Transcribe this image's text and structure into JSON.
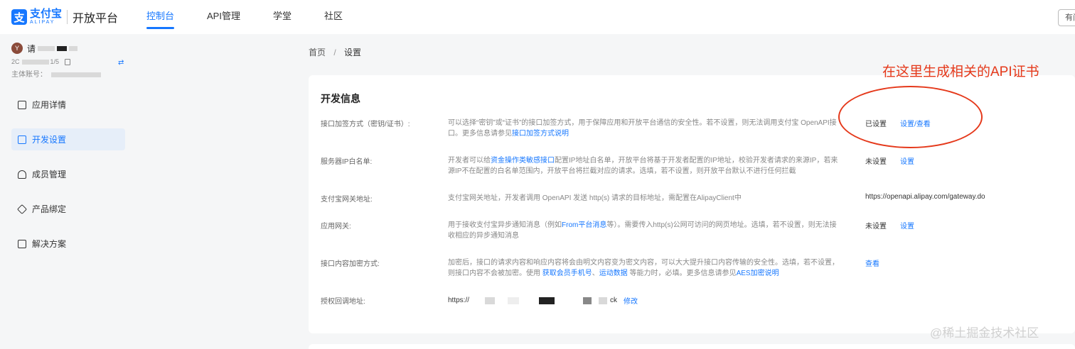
{
  "header": {
    "logo_icon": "支",
    "logo_cn": "支付宝",
    "logo_en": "ALIPAY",
    "platform": "开放平台",
    "nav": [
      {
        "label": "控制台",
        "active": true
      },
      {
        "label": "API管理",
        "active": false
      },
      {
        "label": "学堂",
        "active": false
      },
      {
        "label": "社区",
        "active": false
      }
    ],
    "right_button": "有问"
  },
  "sidebar": {
    "account_name": "请",
    "avatar_letter": "Y",
    "account_id": "2C",
    "account_id_suffix": "1/5",
    "main_account_label": "主体账号：",
    "swap_icon": "swap-icon",
    "menu": [
      {
        "label": "应用详情",
        "icon": "app-detail-icon",
        "active": false
      },
      {
        "label": "开发设置",
        "icon": "dev-settings-icon",
        "active": true
      },
      {
        "label": "成员管理",
        "icon": "members-icon",
        "active": false
      },
      {
        "label": "产品绑定",
        "icon": "product-bind-icon",
        "active": false
      },
      {
        "label": "解决方案",
        "icon": "solution-icon",
        "active": false
      }
    ]
  },
  "breadcrumb": {
    "home": "首页",
    "separator": "/",
    "current": "设置"
  },
  "annotation": {
    "text": "在这里生成相关的API证书",
    "color": "#e5391b"
  },
  "dev_info": {
    "title": "开发信息",
    "rows": [
      {
        "label": "接口加签方式（密钥/证书）:",
        "desc_prefix": "可以选择“密钥”或“证书”的接口加签方式，用于保障应用和开放平台通信的安全性。若不设置，则无法调用支付宝 OpenAPI接口。更多信息请参见",
        "desc_link": "接口加签方式说明",
        "status": "已设置",
        "action": "设置/查看"
      },
      {
        "label": "服务器IP白名单:",
        "desc_prefix": "开发者可以给",
        "desc_link": "资金操作类敏感接口",
        "desc_suffix": "配置IP地址白名单，开放平台将基于开发者配置的IP地址，校验开发者请求的来源IP，若来源IP不在配置的白名单范围内，开放平台将拦截对应的请求。选填，若不设置，则开放平台默认不进行任何拦截",
        "status": "未设置",
        "action": "设置"
      },
      {
        "label": "支付宝网关地址:",
        "desc_prefix": "支付宝网关地址，开发者调用 OpenAPI 发送 http(s) 请求的目标地址，需配置在AlipayClient中",
        "status": "https://openapi.alipay.com/gateway.do"
      },
      {
        "label": "应用网关:",
        "desc_prefix": "用于接收支付宝异步通知消息（例如",
        "desc_link": "From平台消息",
        "desc_suffix": "等）。需要传入http(s)公网可访问的网页地址。选填，若不设置，则无法接收相应的异步通知消息",
        "status": "未设置",
        "action": "设置"
      },
      {
        "label": "接口内容加密方式:",
        "desc_prefix": "加密后，接口的请求内容和响应内容将会由明文内容变为密文内容，可以大大提升接口内容传输的安全性。选填，若不设置，则接口内容不会被加密。使用 ",
        "desc_link": "获取会员手机号",
        "desc_mid": "、",
        "desc_link2": "运动数据",
        "desc_mid2": " 等能力时，必填。更多信息请参见",
        "desc_link3": "AES加密说明",
        "action": "查看"
      },
      {
        "label": "授权回调地址:",
        "callback_prefix": "https://",
        "callback_suffix": "ck",
        "action": "修改"
      }
    ]
  },
  "watermark": "@稀土掘金技术社区"
}
